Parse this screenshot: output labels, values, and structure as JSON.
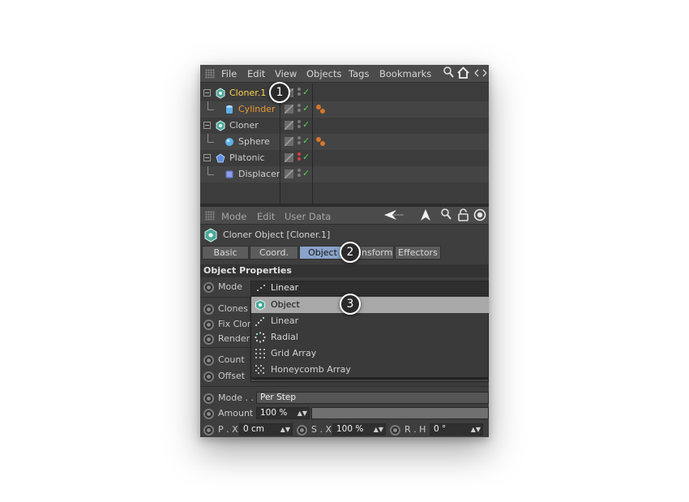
{
  "menubar": {
    "items": [
      "File",
      "Edit",
      "View",
      "Objects",
      "Tags",
      "Bookmarks"
    ],
    "icons": [
      "search-icon",
      "home-icon",
      "arrows-icon"
    ]
  },
  "objects": [
    {
      "name": "Cloner.1",
      "icon": "cloner-icon",
      "state": "selected"
    },
    {
      "name": "Cylinder",
      "icon": "cylinder-icon",
      "state": "child-selected"
    },
    {
      "name": "Cloner",
      "icon": "cloner-icon",
      "state": "normal"
    },
    {
      "name": "Sphere",
      "icon": "sphere-icon",
      "state": "normal"
    },
    {
      "name": "Platonic",
      "icon": "platonic-icon",
      "state": "normal"
    },
    {
      "name": "Displacer",
      "icon": "displacer-icon",
      "state": "normal"
    }
  ],
  "attributes_bar": {
    "items": [
      "Mode",
      "Edit",
      "User Data"
    ]
  },
  "object_title": "Cloner Object [Cloner.1]",
  "tabs": [
    "Basic",
    "Coord.",
    "Object",
    "Transform",
    "Effectors"
  ],
  "active_tab": "Object",
  "section_title": "Object Properties",
  "params": {
    "mode_label": "Mode",
    "mode_value": "Linear",
    "clones_label": "Clones",
    "fix_clone_label": "Fix Clon",
    "render_label": "Render",
    "count_label": "Count",
    "offset_label": "Offset",
    "mode2_label": "Mode . .",
    "mode2_value": "Per Step",
    "amount_label": "Amount",
    "amount_value": "100 %",
    "px_label": "P . X",
    "px_value": "0 cm",
    "sx_label": "S . X",
    "sx_value": "100 %",
    "rh_label": "R . H",
    "rh_value": "0 °"
  },
  "dropdown_options": [
    "Object",
    "Linear",
    "Radial",
    "Grid Array",
    "Honeycomb Array"
  ],
  "dropdown_highlighted": "Object",
  "badges": [
    "1",
    "2",
    "3"
  ],
  "colors": {
    "selected_text": "#ffd34f",
    "child_text": "#e8992f",
    "active_tab": "#8aa3c9",
    "check": "#5ecc5e"
  }
}
